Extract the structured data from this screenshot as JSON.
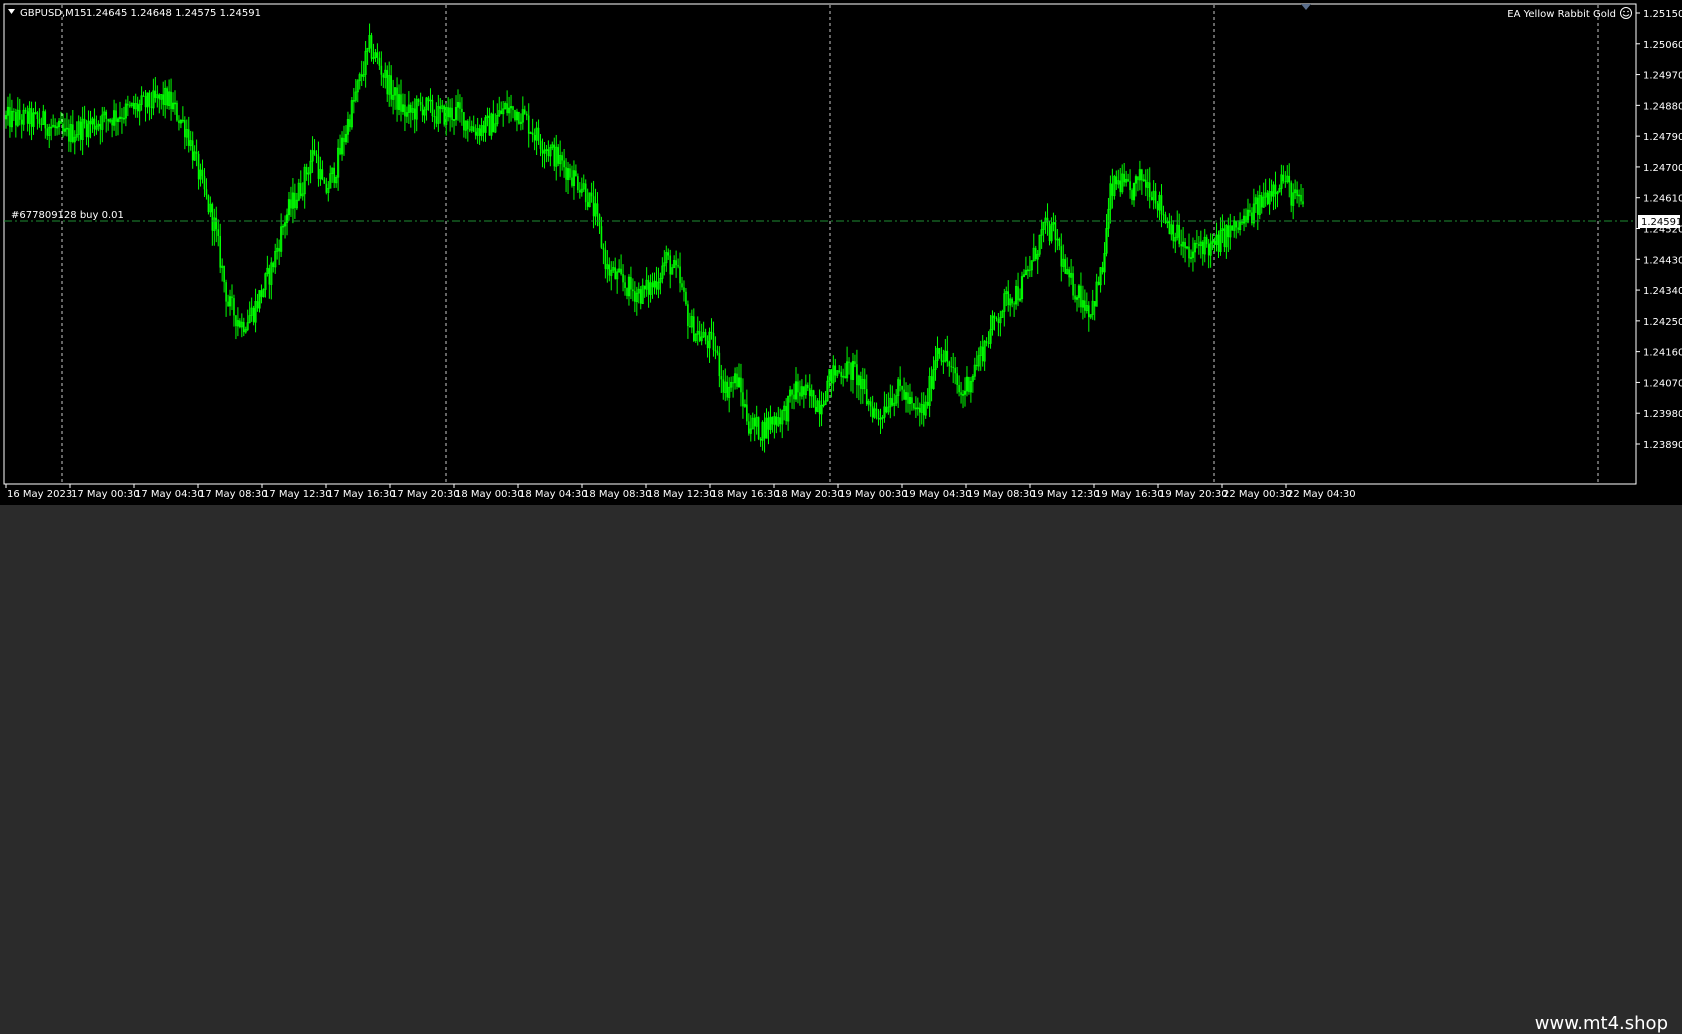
{
  "header": {
    "symbol_label": "GBPUSD,M15",
    "ohlc_label": "1.24645 1.24648 1.24575 1.24591",
    "ea_label": "EA Yellow Rabbit Gold",
    "ea_icon": "smiley-face-icon"
  },
  "order_line": {
    "label": "#677809128 buy 0.01",
    "price": 1.24591
  },
  "current_price_label": "1.24591",
  "price_axis": {
    "ticks": [
      "1.25150",
      "1.25060",
      "1.24970",
      "1.24880",
      "1.24790",
      "1.24700",
      "1.24610",
      "1.24520",
      "1.24430",
      "1.24340",
      "1.24250",
      "1.24160",
      "1.24070",
      "1.23980",
      "1.23890"
    ],
    "top_value": 1.2515,
    "bottom_value": 1.2389
  },
  "time_axis": {
    "ticks": [
      "16 May 2023",
      "17 May 00:30",
      "17 May 04:30",
      "17 May 08:30",
      "17 May 12:30",
      "17 May 16:30",
      "17 May 20:30",
      "18 May 00:30",
      "18 May 04:30",
      "18 May 08:30",
      "18 May 12:30",
      "18 May 16:30",
      "18 May 20:30",
      "19 May 00:30",
      "19 May 04:30",
      "19 May 08:30",
      "19 May 12:30",
      "19 May 16:30",
      "19 May 20:30",
      "22 May 00:30",
      "22 May 04:30"
    ]
  },
  "colors": {
    "background": "#000000",
    "candle": "#00ff00",
    "grid": "#c8c8c8",
    "order_line": "#1e8c32",
    "axis_text": "#ffffff"
  },
  "chart_data": {
    "type": "candlestick",
    "symbol": "GBPUSD",
    "timeframe": "M15",
    "y_range": [
      1.2389,
      1.2515
    ],
    "path_points": [
      {
        "t": 0,
        "price": 1.2484
      },
      {
        "t": 10,
        "price": 1.2484
      },
      {
        "t": 20,
        "price": 1.2483
      },
      {
        "t": 30,
        "price": 1.2479
      },
      {
        "t": 40,
        "price": 1.2482
      },
      {
        "t": 55,
        "price": 1.2485
      },
      {
        "t": 70,
        "price": 1.2488
      },
      {
        "t": 82,
        "price": 1.249
      },
      {
        "t": 92,
        "price": 1.2481
      },
      {
        "t": 100,
        "price": 1.2464
      },
      {
        "t": 106,
        "price": 1.2453
      },
      {
        "t": 113,
        "price": 1.243
      },
      {
        "t": 120,
        "price": 1.2424
      },
      {
        "t": 126,
        "price": 1.2428
      },
      {
        "t": 135,
        "price": 1.244
      },
      {
        "t": 142,
        "price": 1.2455
      },
      {
        "t": 150,
        "price": 1.2464
      },
      {
        "t": 157,
        "price": 1.2475
      },
      {
        "t": 162,
        "price": 1.2462
      },
      {
        "t": 168,
        "price": 1.247
      },
      {
        "t": 174,
        "price": 1.2483
      },
      {
        "t": 180,
        "price": 1.2495
      },
      {
        "t": 185,
        "price": 1.2505
      },
      {
        "t": 190,
        "price": 1.25
      },
      {
        "t": 196,
        "price": 1.2492
      },
      {
        "t": 204,
        "price": 1.2485
      },
      {
        "t": 212,
        "price": 1.2488
      },
      {
        "t": 220,
        "price": 1.2485
      },
      {
        "t": 230,
        "price": 1.2486
      },
      {
        "t": 238,
        "price": 1.2481
      },
      {
        "t": 246,
        "price": 1.2482
      },
      {
        "t": 254,
        "price": 1.2487
      },
      {
        "t": 262,
        "price": 1.2486
      },
      {
        "t": 270,
        "price": 1.2479
      },
      {
        "t": 278,
        "price": 1.2474
      },
      {
        "t": 286,
        "price": 1.2469
      },
      {
        "t": 294,
        "price": 1.2464
      },
      {
        "t": 300,
        "price": 1.2456
      },
      {
        "t": 306,
        "price": 1.244
      },
      {
        "t": 312,
        "price": 1.2437
      },
      {
        "t": 318,
        "price": 1.2434
      },
      {
        "t": 324,
        "price": 1.2433
      },
      {
        "t": 330,
        "price": 1.2436
      },
      {
        "t": 336,
        "price": 1.2443
      },
      {
        "t": 342,
        "price": 1.2438
      },
      {
        "t": 348,
        "price": 1.2424
      },
      {
        "t": 354,
        "price": 1.242
      },
      {
        "t": 360,
        "price": 1.2418
      },
      {
        "t": 366,
        "price": 1.2405
      },
      {
        "t": 372,
        "price": 1.2408
      },
      {
        "t": 378,
        "price": 1.2395
      },
      {
        "t": 384,
        "price": 1.2393
      },
      {
        "t": 390,
        "price": 1.2396
      },
      {
        "t": 396,
        "price": 1.2398
      },
      {
        "t": 402,
        "price": 1.2405
      },
      {
        "t": 408,
        "price": 1.2403
      },
      {
        "t": 414,
        "price": 1.2401
      },
      {
        "t": 420,
        "price": 1.2409
      },
      {
        "t": 426,
        "price": 1.2411
      },
      {
        "t": 432,
        "price": 1.241
      },
      {
        "t": 438,
        "price": 1.2402
      },
      {
        "t": 444,
        "price": 1.2397
      },
      {
        "t": 450,
        "price": 1.2403
      },
      {
        "t": 456,
        "price": 1.2405
      },
      {
        "t": 462,
        "price": 1.2398
      },
      {
        "t": 468,
        "price": 1.2399
      },
      {
        "t": 474,
        "price": 1.2418
      },
      {
        "t": 480,
        "price": 1.2412
      },
      {
        "t": 486,
        "price": 1.2403
      },
      {
        "t": 492,
        "price": 1.241
      },
      {
        "t": 498,
        "price": 1.2418
      },
      {
        "t": 504,
        "price": 1.2426
      },
      {
        "t": 510,
        "price": 1.2432
      },
      {
        "t": 516,
        "price": 1.2434
      },
      {
        "t": 522,
        "price": 1.2442
      },
      {
        "t": 528,
        "price": 1.2452
      },
      {
        "t": 534,
        "price": 1.245
      },
      {
        "t": 540,
        "price": 1.2437
      },
      {
        "t": 546,
        "price": 1.2433
      },
      {
        "t": 552,
        "price": 1.2428
      },
      {
        "t": 558,
        "price": 1.244
      },
      {
        "t": 562,
        "price": 1.2462
      },
      {
        "t": 566,
        "price": 1.2466
      },
      {
        "t": 572,
        "price": 1.2462
      },
      {
        "t": 578,
        "price": 1.2467
      },
      {
        "t": 584,
        "price": 1.2463
      },
      {
        "t": 590,
        "price": 1.2455
      },
      {
        "t": 596,
        "price": 1.245
      },
      {
        "t": 602,
        "price": 1.2443
      },
      {
        "t": 608,
        "price": 1.2448
      },
      {
        "t": 614,
        "price": 1.2446
      },
      {
        "t": 620,
        "price": 1.245
      },
      {
        "t": 626,
        "price": 1.2452
      },
      {
        "t": 632,
        "price": 1.2455
      },
      {
        "t": 638,
        "price": 1.2459
      },
      {
        "t": 644,
        "price": 1.2464
      },
      {
        "t": 650,
        "price": 1.2467
      },
      {
        "t": 655,
        "price": 1.2461
      },
      {
        "t": 660,
        "price": 1.2459
      }
    ],
    "last_close": 1.24591
  }
}
